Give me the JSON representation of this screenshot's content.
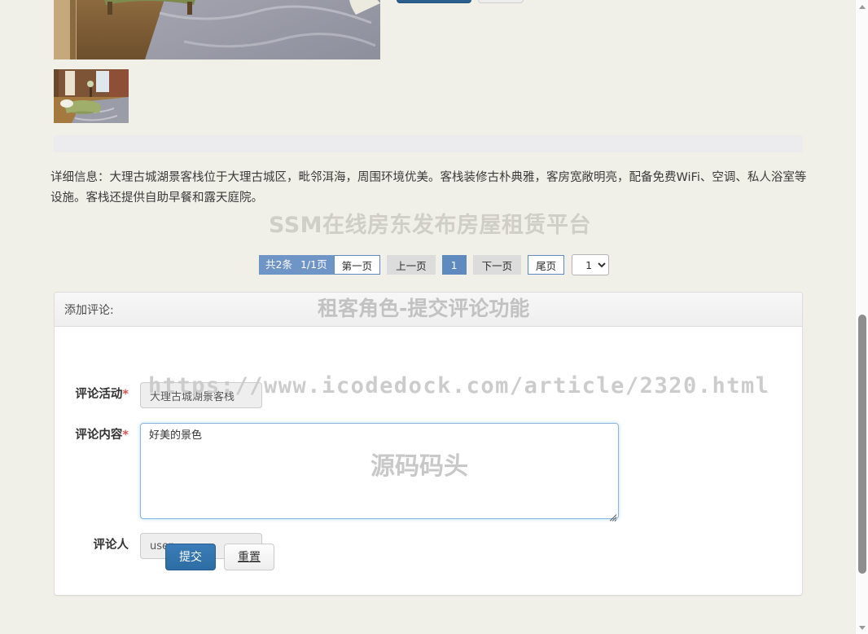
{
  "page": {
    "background_color": "#f1f0e8",
    "accent_color": "#2d6da3",
    "pager_accent": "#5f8ac0"
  },
  "top_buttons": {
    "primary_label": "",
    "default_label": ""
  },
  "photos": {
    "large_alt": "客栈房间大图",
    "thumb_alt": "客栈房间缩略图"
  },
  "detail": {
    "text": "详细信息：大理古城湖景客栈位于大理古城区，毗邻洱海，周围环境优美。客栈装修古朴典雅，客房宽敞明亮，配备免费WiFi、空调、私人浴室等设施。客栈还提供自助早餐和露天庭院。"
  },
  "pagination": {
    "total_label": "共2条",
    "page_label": "1/1页",
    "first": "第一页",
    "prev": "上一页",
    "current": "1",
    "next": "下一页",
    "last": "尾页",
    "page_select_value": "1",
    "page_select_options": [
      "1"
    ]
  },
  "panel": {
    "header_title": "添加评论:",
    "fields": {
      "activity": {
        "label": "评论活动",
        "required_mark": "*",
        "value": "大理古城湖景客栈"
      },
      "content": {
        "label": "评论内容",
        "required_mark": "*",
        "value": "好美的景色"
      },
      "author": {
        "label": "评论人",
        "required_mark": "",
        "value": "user"
      }
    },
    "buttons": {
      "submit": "提交",
      "reset": "重置"
    }
  },
  "watermarks": {
    "site_title": "SSM在线房东发布房屋租赁平台",
    "feature": "租客角色-提交评论功能",
    "url": "https://www.icodedock.com/article/2320.html",
    "brand": "源码码头"
  }
}
